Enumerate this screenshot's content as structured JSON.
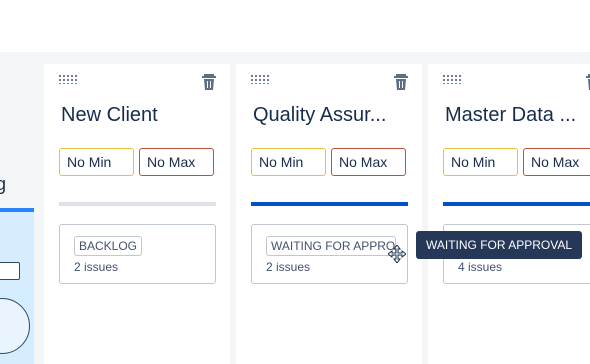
{
  "left_partial": {
    "glyph": "g"
  },
  "columns": [
    {
      "title": "New Client",
      "min_label": "No Min",
      "max_label": "No Max",
      "card": {
        "status": "BACKLOG",
        "count": "2 issues"
      }
    },
    {
      "title": "Quality Assur...",
      "min_label": "No Min",
      "max_label": "No Max",
      "card": {
        "status": "WAITING FOR APPRO...",
        "count": "2 issues"
      }
    },
    {
      "title": "Master Data ...",
      "min_label": "No Min",
      "max_label": "No Max",
      "card": {
        "status": "",
        "count": "4 issues"
      }
    }
  ],
  "tooltip": {
    "text": "WAITING FOR APPROVAL"
  },
  "colors": {
    "min_border": "#e5c23a",
    "max_border": "#c0503a",
    "accent_bar": "#0052cc",
    "tooltip_bg": "#253858"
  },
  "icons": [
    "drag-handle-icon",
    "trash-icon",
    "move-cursor-icon"
  ]
}
